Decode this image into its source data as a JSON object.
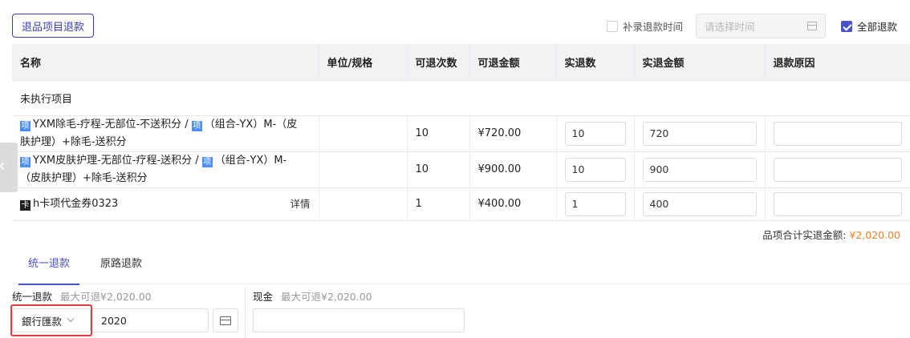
{
  "toolbar": {
    "return_items_button": "退品项目退款",
    "supplement_time_label": "补录退款时间",
    "supplement_time_checked": false,
    "time_placeholder": "请选择时间",
    "all_refund_label": "全部退款",
    "all_refund_checked": true
  },
  "table": {
    "headers": [
      "名称",
      "单位/规格",
      "可退次数",
      "可退金额",
      "实退数",
      "实退金额",
      "退款原因"
    ],
    "group_label": "未执行项目",
    "rows": [
      {
        "tag1": "项",
        "line1a": "YXM除毛-疗程-无部位-不送积分 / ",
        "tag2": "项",
        "line1b": "（组合-YX）M-（皮",
        "line2": "肤护理）+除毛-送积分",
        "unit": "",
        "times": "10",
        "amount": "¥720.00",
        "qty": "10",
        "refund_amount": "720",
        "reason": ""
      },
      {
        "tag1": "项",
        "line1a": "YXM皮肤护理-无部位-疗程-送积分 / ",
        "tag2": "项",
        "line1b": "（组合-YX）M-",
        "line2": "（皮肤护理）+除毛-送积分",
        "unit": "",
        "times": "10",
        "amount": "¥900.00",
        "qty": "10",
        "refund_amount": "900",
        "reason": ""
      },
      {
        "tag1": "卡",
        "name": "h卡项代金券0323",
        "detail": "详情",
        "unit": "",
        "times": "1",
        "amount": "¥400.00",
        "qty": "1",
        "refund_amount": "400",
        "reason": ""
      }
    ]
  },
  "summary": {
    "total_label": "品项合计实退金额: ",
    "total_value": "¥2,020.00"
  },
  "tabs": [
    "统一退款",
    "原路退款"
  ],
  "payment": {
    "unified_label": "统一退款",
    "unified_hint": "最大可退¥2,020.00",
    "method_value": "銀行匯款",
    "amount_value": "2020",
    "cash_label": "现金",
    "cash_hint": "最大可退¥2,020.00",
    "cash_value": ""
  },
  "colors": {
    "accent": "#4a52c8",
    "total": "#f07f2a",
    "highlight": "#e24040"
  }
}
